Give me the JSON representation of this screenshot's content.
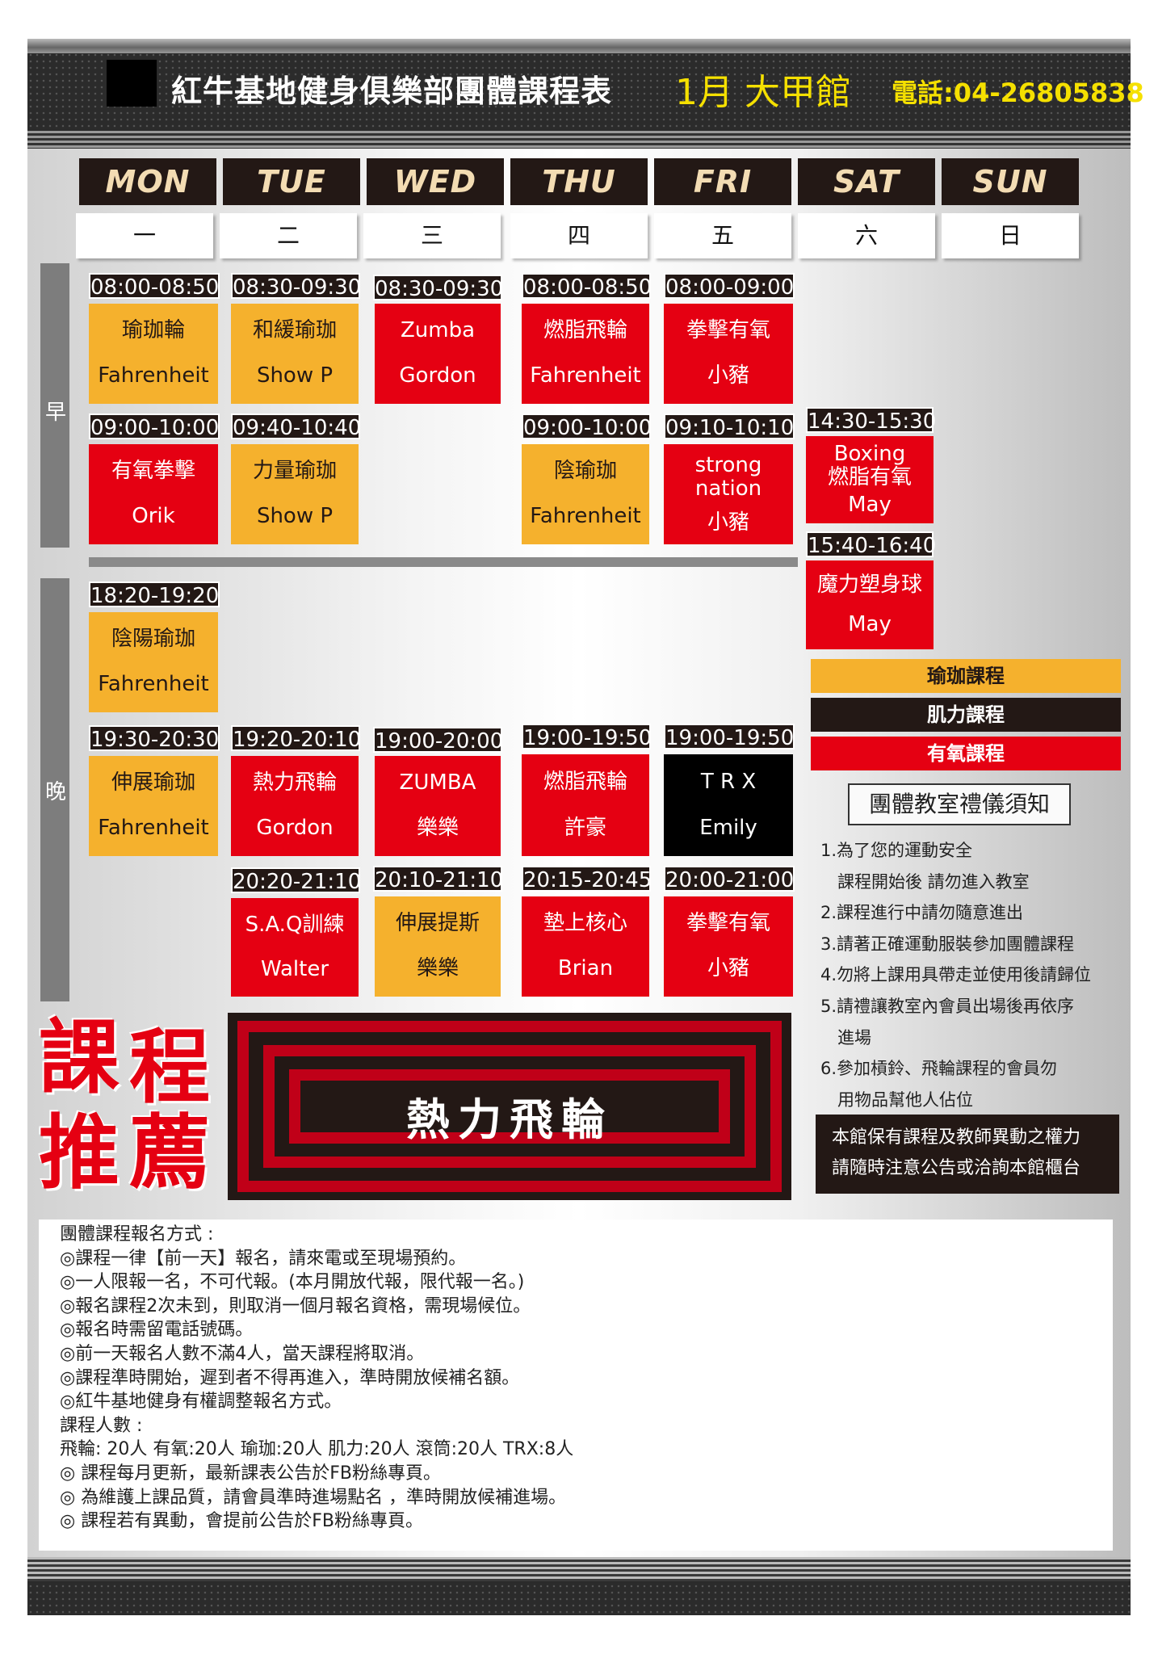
{
  "header": {
    "title": "紅牛基地健身俱樂部團體課程表",
    "month_branch": "1月 大甲館",
    "phone": "電話:04-26805838"
  },
  "days": [
    {
      "en": "MON",
      "zh": "一"
    },
    {
      "en": "TUE",
      "zh": "二"
    },
    {
      "en": "WED",
      "zh": "三"
    },
    {
      "en": "THU",
      "zh": "四"
    },
    {
      "en": "FRI",
      "zh": "五"
    },
    {
      "en": "SAT",
      "zh": "六"
    },
    {
      "en": "SUN",
      "zh": "日"
    }
  ],
  "periods": {
    "morning": "早",
    "evening": "晚"
  },
  "classes": [
    {
      "day": "MON",
      "time": "08:00-08:50",
      "name": "瑜珈輪",
      "teacher": "Fahrenheit",
      "type": "yoga"
    },
    {
      "day": "MON",
      "time": "09:00-10:00",
      "name": "有氧拳擊",
      "teacher": "Orik",
      "type": "aerobic"
    },
    {
      "day": "MON",
      "time": "18:20-19:20",
      "name": "陰陽瑜珈",
      "teacher": "Fahrenheit",
      "type": "yoga"
    },
    {
      "day": "MON",
      "time": "19:30-20:30",
      "name": "伸展瑜珈",
      "teacher": "Fahrenheit",
      "type": "yoga"
    },
    {
      "day": "TUE",
      "time": "08:30-09:30",
      "name": "和緩瑜珈",
      "teacher": "Show P",
      "type": "yoga"
    },
    {
      "day": "TUE",
      "time": "09:40-10:40",
      "name": "力量瑜珈",
      "teacher": "Show P",
      "type": "yoga"
    },
    {
      "day": "TUE",
      "time": "19:20-20:10",
      "name": "熱力飛輪",
      "teacher": "Gordon",
      "type": "aerobic"
    },
    {
      "day": "TUE",
      "time": "20:20-21:10",
      "name": "S.A.Q訓練",
      "teacher": "Walter",
      "type": "aerobic"
    },
    {
      "day": "WED",
      "time": "08:30-09:30",
      "name": "Zumba",
      "teacher": "Gordon",
      "type": "aerobic"
    },
    {
      "day": "WED",
      "time": "19:00-20:00",
      "name": "ZUMBA",
      "teacher": "樂樂",
      "type": "aerobic"
    },
    {
      "day": "WED",
      "time": "20:10-21:10",
      "name": "伸展提斯",
      "teacher": "樂樂",
      "type": "yoga"
    },
    {
      "day": "THU",
      "time": "08:00-08:50",
      "name": "燃脂飛輪",
      "teacher": "Fahrenheit",
      "type": "aerobic"
    },
    {
      "day": "THU",
      "time": "09:00-10:00",
      "name": "陰瑜珈",
      "teacher": "Fahrenheit",
      "type": "yoga"
    },
    {
      "day": "THU",
      "time": "19:00-19:50",
      "name": "燃脂飛輪",
      "teacher": "許豪",
      "type": "aerobic"
    },
    {
      "day": "THU",
      "time": "20:15-20:45",
      "name": "墊上核心",
      "teacher": "Brian",
      "type": "aerobic"
    },
    {
      "day": "FRI",
      "time": "08:00-09:00",
      "name": "拳擊有氧",
      "teacher": "小豬",
      "type": "aerobic"
    },
    {
      "day": "FRI",
      "time": "09:10-10:10",
      "name": "strong nation",
      "teacher": "小豬",
      "type": "aerobic"
    },
    {
      "day": "FRI",
      "time": "19:00-19:50",
      "name": "T R X",
      "teacher": "Emily",
      "type": "strength"
    },
    {
      "day": "FRI",
      "time": "20:00-21:00",
      "name": "拳擊有氧",
      "teacher": "小豬",
      "type": "aerobic"
    },
    {
      "day": "SAT",
      "time": "14:30-15:30",
      "name": "Boxing 燃脂有氧",
      "teacher": "May",
      "type": "aerobic"
    },
    {
      "day": "SAT",
      "time": "15:40-16:40",
      "name": "魔力塑身球",
      "teacher": "May",
      "type": "aerobic"
    }
  ],
  "legend": [
    {
      "label": "瑜珈課程",
      "color": "#f5b12d"
    },
    {
      "label": "肌力課程",
      "color": "#231815"
    },
    {
      "label": "有氧課程",
      "color": "#e50012"
    }
  ],
  "etiquette": {
    "title": "團體教室禮儀須知",
    "lines": [
      "1.為了您的運動安全",
      "　課程開始後 請勿進入教室",
      "2.課程進行中請勿隨意進出",
      "3.請著正確運動服裝參加團體課程",
      "4.勿將上課用具帶走並使用後請歸位",
      "5.請禮讓教室內會員出場後再依序",
      "　進場",
      "6.參加槓鈴、飛輪課程的會員勿",
      "　用物品幫他人佔位"
    ]
  },
  "notice": {
    "line1": "本館保有課程及教師異動之權力",
    "line2": "請隨時注意公告或洽詢本館櫃台"
  },
  "promo": {
    "label_chars": [
      "課",
      "程",
      "推",
      "薦"
    ],
    "class_name": "熱力飛輪"
  },
  "signup": {
    "lines": [
      "團體課程報名方式 :",
      "◎課程一律【前一天】報名，請來電或至現場預約。",
      "◎一人限報一名，不可代報。(本月開放代報，限代報一名。)",
      "◎報名課程2次未到，則取消一個月報名資格，需現場候位。",
      "◎報名時需留電話號碼。",
      "◎前一天報名人數不滿4人，當天課程將取消。",
      "◎課程準時開始，遲到者不得再進入，準時開放候補名額。",
      "◎紅牛基地健身有權調整報名方式。",
      "課程人數 :",
      "飛輪: 20人  有氧:20人  瑜珈:20人  肌力:20人  滾筒:20人 TRX:8人",
      "◎ 課程每月更新，最新課表公告於FB粉絲專頁。",
      "◎ 為維護上課品質，請會員準時進場點名 ，準時開放候補進場。",
      "◎ 課程若有異動，會提前公告於FB粉絲專頁。"
    ]
  },
  "colors": {
    "yoga": "#f5b12d",
    "aerobic": "#e50012",
    "strength": "#000000",
    "header_accent": "#f5e000"
  }
}
